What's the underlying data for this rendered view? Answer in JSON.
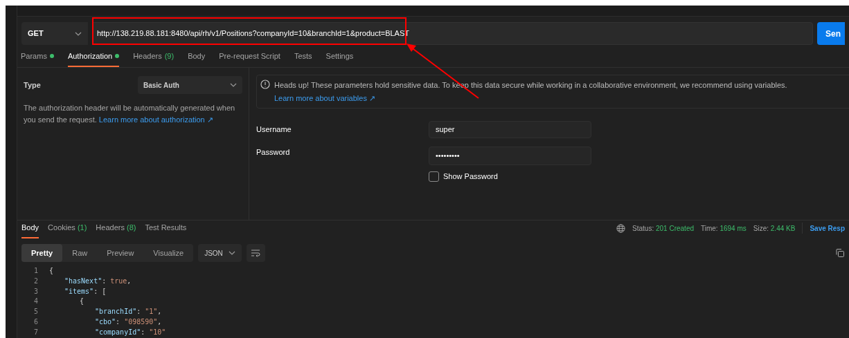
{
  "request": {
    "method": "GET",
    "url": "http://138.219.88.181:8480/api/rh/v1/Positions?companyId=10&branchId=1&product=BLAST",
    "send_label": "Sen"
  },
  "request_tabs": [
    {
      "label": "Params",
      "dot": true,
      "selected": false
    },
    {
      "label": "Authorization",
      "dot": true,
      "selected": true
    },
    {
      "label": "Headers",
      "count": "(9)",
      "dot": false,
      "selected": false
    },
    {
      "label": "Body",
      "dot": false,
      "selected": false
    },
    {
      "label": "Pre-request Script",
      "dot": false,
      "selected": false
    },
    {
      "label": "Tests",
      "dot": false,
      "selected": false
    },
    {
      "label": "Settings",
      "dot": false,
      "selected": false
    }
  ],
  "auth": {
    "type_label": "Type",
    "type_value": "Basic Auth",
    "description": "The authorization header will be automatically generated when you send the request.",
    "description_link": "Learn more about authorization ↗",
    "notice": "Heads up! These parameters hold sensitive data. To keep this data secure while working in a collaborative environment, we recommend using variables.",
    "notice_link": "Learn more about variables ↗",
    "username_label": "Username",
    "username": "super",
    "password_label": "Password",
    "password": "•••••••••",
    "show_password_label": "Show Password",
    "show_password": false
  },
  "response_tabs": [
    {
      "label": "Body",
      "selected": true
    },
    {
      "label": "Cookies",
      "count": "(1)",
      "selected": false
    },
    {
      "label": "Headers",
      "count": "(8)",
      "selected": false
    },
    {
      "label": "Test Results",
      "selected": false
    }
  ],
  "status": {
    "status_label": "Status:",
    "status": "201 Created",
    "time_label": "Time:",
    "time": "1694 ms",
    "size_label": "Size:",
    "size": "2.44 KB",
    "save_label": "Save Resp"
  },
  "view_modes": [
    {
      "label": "Pretty",
      "selected": true
    },
    {
      "label": "Raw",
      "selected": false
    },
    {
      "label": "Preview",
      "selected": false
    },
    {
      "label": "Visualize",
      "selected": false
    }
  ],
  "format": "JSON",
  "code_lines": [
    {
      "number": "1",
      "parts": [
        {
          "kind": "punct",
          "text": "{"
        }
      ],
      "children": [
        {
          "number": "2",
          "parts": [
            {
              "kind": "key",
              "text": "\"hasNext\""
            },
            {
              "kind": "punct",
              "text": ": "
            },
            {
              "kind": "literal",
              "text": "true"
            },
            {
              "kind": "punct",
              "text": ","
            }
          ]
        },
        {
          "number": "3",
          "parts": [
            {
              "kind": "key",
              "text": "\"items\""
            },
            {
              "kind": "punct",
              "text": ": ["
            }
          ],
          "children": [
            {
              "number": "4",
              "parts": [
                {
                  "kind": "punct",
                  "text": "{"
                }
              ],
              "children": [
                {
                  "number": "5",
                  "parts": [
                    {
                      "kind": "key",
                      "text": "\"branchId\""
                    },
                    {
                      "kind": "punct",
                      "text": ": "
                    },
                    {
                      "kind": "string",
                      "text": "\"1\""
                    },
                    {
                      "kind": "punct",
                      "text": ","
                    }
                  ]
                },
                {
                  "number": "6",
                  "parts": [
                    {
                      "kind": "key",
                      "text": "\"cbo\""
                    },
                    {
                      "kind": "punct",
                      "text": ": "
                    },
                    {
                      "kind": "string",
                      "text": "\"098590\""
                    },
                    {
                      "kind": "punct",
                      "text": ","
                    }
                  ]
                },
                {
                  "number": "7",
                  "parts": [
                    {
                      "kind": "key",
                      "text": "\"companyId\""
                    },
                    {
                      "kind": "punct",
                      "text": ": "
                    },
                    {
                      "kind": "string",
                      "text": "\"10\""
                    }
                  ]
                }
              ]
            }
          ]
        }
      ]
    }
  ]
}
